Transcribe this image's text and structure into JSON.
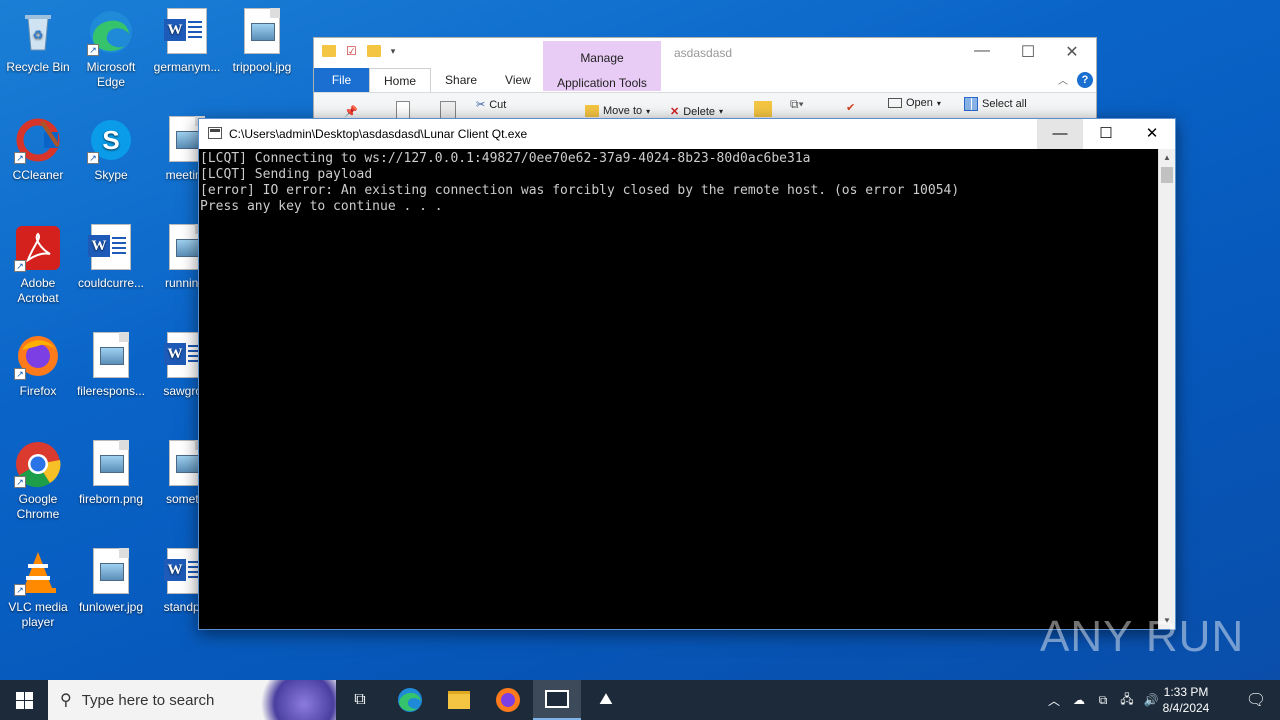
{
  "desktop": {
    "icons": [
      {
        "label": "Recycle Bin",
        "icon": "recycle-bin-icon"
      },
      {
        "label": "Microsoft Edge",
        "icon": "edge-icon"
      },
      {
        "label": "germanym...",
        "icon": "word-doc-icon"
      },
      {
        "label": "trippool.jpg",
        "icon": "image-file-icon"
      },
      {
        "label": "CCleaner",
        "icon": "ccleaner-icon"
      },
      {
        "label": "Skype",
        "icon": "skype-icon"
      },
      {
        "label": "meeting",
        "icon": "image-file-icon"
      },
      {
        "label": "Adobe Acrobat",
        "icon": "acrobat-icon"
      },
      {
        "label": "couldcurre...",
        "icon": "word-doc-icon"
      },
      {
        "label": "runningr",
        "icon": "image-file-icon"
      },
      {
        "label": "Firefox",
        "icon": "firefox-icon"
      },
      {
        "label": "filerespons...",
        "icon": "image-file-icon"
      },
      {
        "label": "sawgrow",
        "icon": "word-doc-icon"
      },
      {
        "label": "Google Chrome",
        "icon": "chrome-icon"
      },
      {
        "label": "fireborn.png",
        "icon": "image-file-icon"
      },
      {
        "label": "somethi",
        "icon": "image-file-icon"
      },
      {
        "label": "VLC media player",
        "icon": "vlc-icon"
      },
      {
        "label": "funlower.jpg",
        "icon": "image-file-icon"
      },
      {
        "label": "standpre",
        "icon": "word-doc-icon"
      }
    ]
  },
  "explorer": {
    "title": "asdasdasd",
    "manage_label": "Manage",
    "app_tools_label": "Application Tools",
    "tabs": {
      "file": "File",
      "home": "Home",
      "share": "Share",
      "view": "View"
    },
    "ribbon": {
      "cut": "Cut",
      "move_to": "Move to",
      "delete": "Delete",
      "open": "Open",
      "select_all": "Select all"
    },
    "help": "?"
  },
  "console": {
    "title": "C:\\Users\\admin\\Desktop\\asdasdasd\\Lunar Client Qt.exe",
    "lines": [
      "[LCQT] Connecting to ws://127.0.0.1:49827/0ee70e62-37a9-4024-8b23-80d0ac6be31a",
      "[LCQT] Sending payload",
      "[error] IO error: An existing connection was forcibly closed by the remote host. (os error 10054)",
      "Press any key to continue . . ."
    ],
    "controls": {
      "minimize": "—",
      "maximize": "☐",
      "close": "✕"
    }
  },
  "watermark": "ANY RUN",
  "taskbar": {
    "search_placeholder": "Type here to search",
    "time": "1:33 PM",
    "date": "8/4/2024"
  },
  "colors": {
    "desktop_bg": "#0a64c8",
    "taskbar_bg": "#1c2a3a",
    "console_text": "#cccccc",
    "manage_tab": "#e9ccf5",
    "file_tab": "#1a6fd0"
  }
}
